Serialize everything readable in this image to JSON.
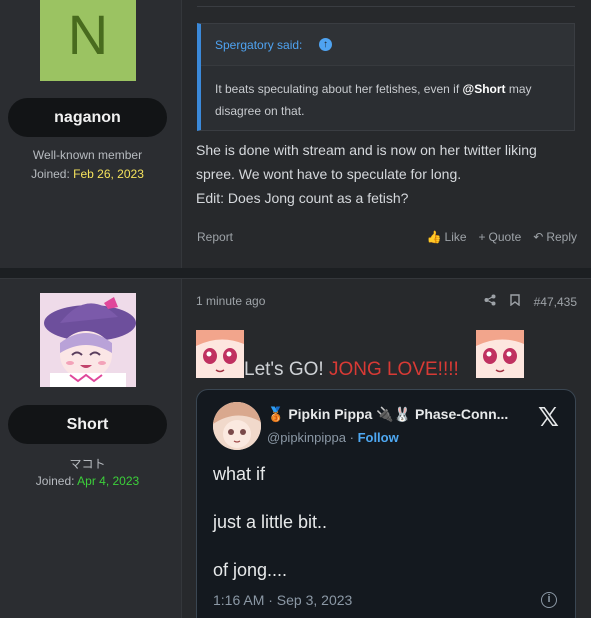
{
  "posts": [
    {
      "author": {
        "avatar_letter": "N",
        "name": "naganon",
        "title": "Well-known member",
        "joined_label": "Joined:",
        "joined_date": "Feb 26, 2023"
      },
      "quote": {
        "author_said": "Spergatory said:",
        "text_before": "It beats speculating about her fetishes, even if ",
        "mention": "@Short",
        "text_after": " may disagree on that."
      },
      "body": [
        "She is done with stream and is now on her twitter liking spree. We wont have to speculate for long.",
        "Edit: Does Jong count as a fetish?"
      ],
      "footer": {
        "report": "Report",
        "like": "Like",
        "quote": "Quote",
        "reply": "Reply"
      }
    },
    {
      "author": {
        "name": "Short",
        "title": "マコト",
        "joined_label": "Joined:",
        "joined_date": "Apr 4, 2023"
      },
      "meta": {
        "time": "1 minute ago",
        "post_number": "#47,435"
      },
      "headline_plain": "Let's GO! ",
      "headline_highlight": "JONG LOVE!!!!",
      "tweet": {
        "display_name": "🥉 Pipkin Pippa 🔌🐰 Phase-Conn...",
        "handle": "@pipkinpippa",
        "follow": "Follow",
        "lines": [
          "what if",
          "just a little bit..",
          "of jong...."
        ],
        "timestamp": "1:16 AM · Sep 3, 2023"
      }
    }
  ],
  "colors": {
    "accent_blue": "#4fa3f1",
    "joined_date_1": "#f5e25c",
    "joined_date_2": "#3ccf3a",
    "highlight_red": "#d83a35"
  }
}
